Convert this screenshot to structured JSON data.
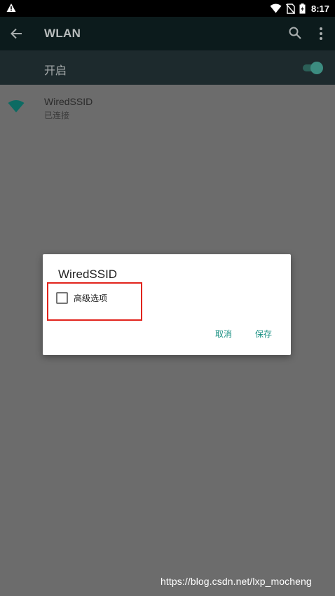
{
  "status_bar": {
    "time": "8:17",
    "icons": [
      "warning-icon",
      "wifi-signal-icon",
      "no-sim-icon",
      "battery-icon"
    ]
  },
  "app_bar": {
    "title": "WLAN",
    "icons": [
      "back-arrow-icon",
      "search-icon",
      "more-vert-icon"
    ]
  },
  "switch_bar": {
    "label": "开启",
    "enabled": true
  },
  "network": {
    "ssid": "WiredSSID",
    "status": "已连接",
    "icon": "wifi-full-icon"
  },
  "dialog": {
    "title": "WiredSSID",
    "advanced_label": "高级选项",
    "advanced_checked": false,
    "cancel_label": "取消",
    "save_label": "保存"
  },
  "watermark": "https://blog.csdn.net/lxp_mocheng",
  "colors": {
    "accent": "#1a9083",
    "highlight": "#e1231c",
    "app_bar_bg": "#0c1b1c",
    "switch_bar_bg": "#1d2a2d",
    "scrim": "#6c6c6c"
  }
}
